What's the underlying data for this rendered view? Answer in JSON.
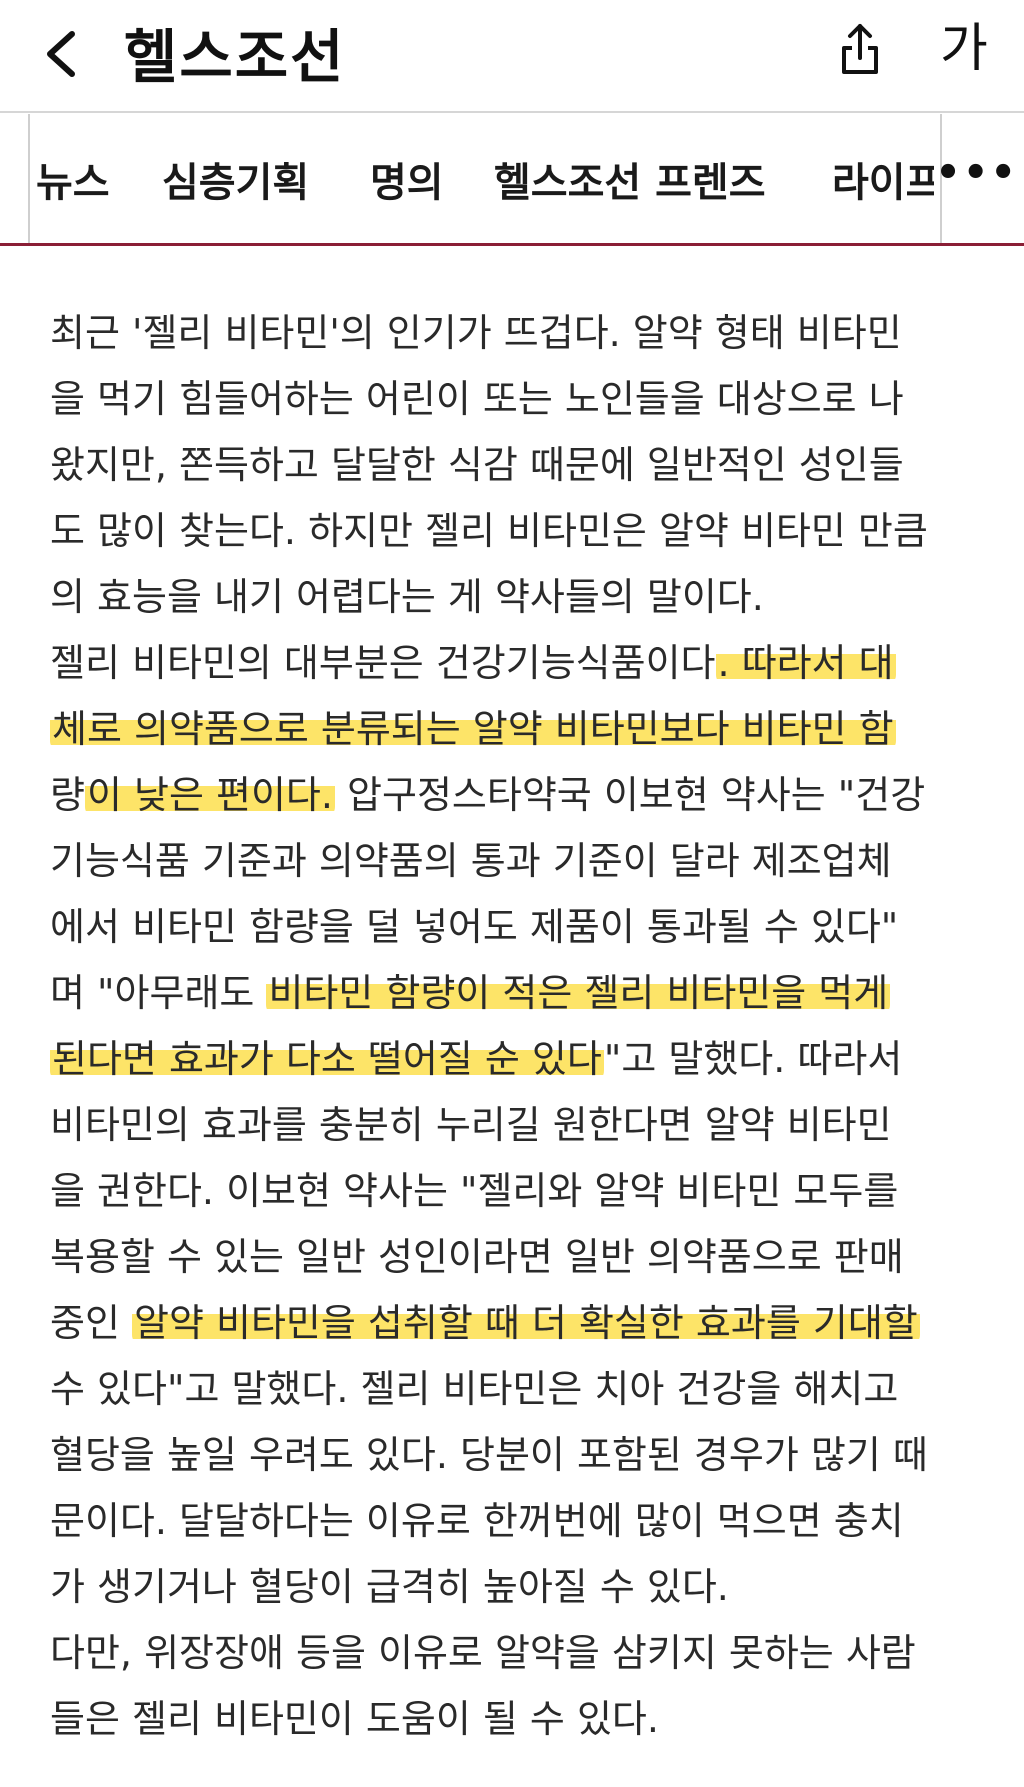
{
  "header": {
    "logo": "헬스조선",
    "font_button": "가",
    "icons": [
      "chevron-left-icon",
      "share-icon"
    ]
  },
  "nav": {
    "items": [
      "뉴스",
      "심층기획",
      "명의",
      "헬스조선 프렌즈",
      "라이프"
    ],
    "more": "•••",
    "accent_color": "#8a1e35"
  },
  "highlight_color": "#fde468",
  "article": {
    "lines": [
      {
        "pre": "최근 '젤리 비타민'의 인기가 뜨겁다. 알약 형태 비타민",
        "hl": "",
        "post": ""
      },
      {
        "pre": "을 먹기 힘들어하는 어린이 또는 노인들을 대상으로 나",
        "hl": "",
        "post": ""
      },
      {
        "pre": "왔지만, 쫀득하고 달달한 식감 때문에 일반적인 성인들",
        "hl": "",
        "post": ""
      },
      {
        "pre": "도 많이 찾는다. 하지만 젤리 비타민은 알약 비타민 만큼",
        "hl": "",
        "post": ""
      },
      {
        "pre": "의 효능을 내기 어렵다는 게 약사들의 말이다.",
        "hl": "",
        "post": ""
      },
      {
        "pre": "젤리 비타민의 대부분은 건강기능식품이다",
        "hl": ". 따라서 대",
        "post": ""
      },
      {
        "pre": "",
        "hl": "체로 의약품으로 분류되는 알약 비타민보다 비타민 함",
        "post": ""
      },
      {
        "pre": "량",
        "hl": "이 낮은 편이다.",
        "post": " 압구정스타약국 이보현 약사는 \"건강"
      },
      {
        "pre": "기능식품 기준과 의약품의 통과 기준이 달라 제조업체",
        "hl": "",
        "post": ""
      },
      {
        "pre": "에서 비타민 함량을 덜 넣어도 제품이 통과될 수 있다\"",
        "hl": "",
        "post": ""
      },
      {
        "pre": "며 \"아무래도 ",
        "hl": "비타민 함량이 적은 젤리 비타민을 먹게",
        "post": ""
      },
      {
        "pre": "",
        "hl": "된다면 효과가 다소 떨어질 순 있다",
        "post": "\"고 말했다. 따라서"
      },
      {
        "pre": "비타민의 효과를 충분히 누리길 원한다면 알약 비타민",
        "hl": "",
        "post": ""
      },
      {
        "pre": "을 권한다. 이보현 약사는 \"젤리와 알약 비타민 모두를",
        "hl": "",
        "post": ""
      },
      {
        "pre": "복용할 수 있는 일반 성인이라면 일반 의약품으로 판매",
        "hl": "",
        "post": ""
      },
      {
        "pre": "중인 ",
        "hl": "알약 비타민을 섭취할 때 더 확실한 효과를 기대할",
        "post": ""
      },
      {
        "pre": "수 있다\"고 말했다. 젤리 비타민은 치아 건강을 해치고",
        "hl": "",
        "post": ""
      },
      {
        "pre": "혈당을 높일 우려도 있다. 당분이 포함된 경우가 많기 때",
        "hl": "",
        "post": ""
      },
      {
        "pre": "문이다. 달달하다는 이유로 한꺼번에 많이 먹으면 충치",
        "hl": "",
        "post": ""
      },
      {
        "pre": "가 생기거나 혈당이 급격히 높아질 수 있다.",
        "hl": "",
        "post": ""
      },
      {
        "pre": "다만, 위장장애 등을 이유로 알약을 삼키지 못하는 사람",
        "hl": "",
        "post": ""
      },
      {
        "pre": "들은 젤리 비타민이 도움이 될 수 있다.",
        "hl": "",
        "post": ""
      }
    ]
  }
}
